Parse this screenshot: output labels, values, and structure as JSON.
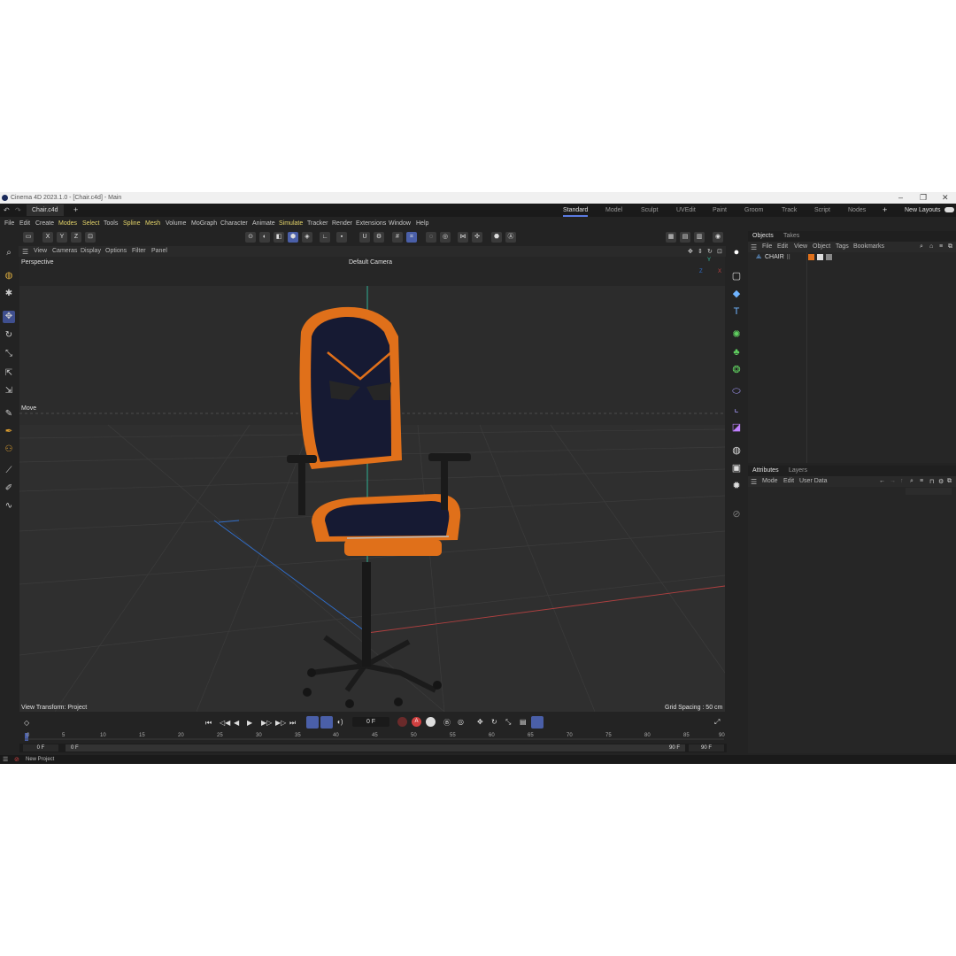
{
  "window": {
    "title": "Cinema 4D 2023.1.0 - [Chair.c4d] - Main",
    "minimize": "–",
    "maximize": "❐",
    "close": "✕"
  },
  "tabs": {
    "document": "Chair.c4d",
    "new_tab": "+"
  },
  "layouts": [
    "Standard",
    "Model",
    "Sculpt",
    "UVEdit",
    "Paint",
    "Groom",
    "Track",
    "Script",
    "Nodes"
  ],
  "layout_add": "+",
  "new_layouts": "New Layouts",
  "menu": [
    "File",
    "Edit",
    "Create",
    "Modes",
    "Select",
    "Tools",
    "Spline",
    "Mesh",
    "Volume",
    "MoGraph",
    "Character",
    "Animate",
    "Simulate",
    "Tracker",
    "Render",
    "Extensions",
    "Window",
    "Help"
  ],
  "axis_buttons": [
    "X",
    "Y",
    "Z"
  ],
  "viewport_menu": [
    "View",
    "Cameras",
    "Display",
    "Options",
    "Filter",
    "Panel"
  ],
  "viewport": {
    "projection": "Perspective",
    "camera": "Default Camera",
    "tool": "Move",
    "view_transform": "View Transform: Project",
    "grid_spacing": "Grid Spacing : 50 cm",
    "axis_labels": {
      "y": "Y",
      "z": "Z",
      "x": "X"
    }
  },
  "objects_panel": {
    "tabs": [
      "Objects",
      "Takes"
    ],
    "menu": [
      "File",
      "Edit",
      "View",
      "Object",
      "Tags",
      "Bookmarks"
    ],
    "items": [
      {
        "name": "CHAIR"
      }
    ]
  },
  "attributes_panel": {
    "tabs": [
      "Attributes",
      "Layers"
    ],
    "menu": [
      "Mode",
      "Edit",
      "User Data"
    ]
  },
  "timeline": {
    "current_frame": "0 F",
    "ticks": [
      "0",
      "5",
      "10",
      "15",
      "20",
      "25",
      "30",
      "35",
      "40",
      "45",
      "50",
      "55",
      "60",
      "65",
      "70",
      "75",
      "80",
      "85",
      "90"
    ],
    "start_field": "0 F",
    "range_start": "0 F",
    "range_end": "90 F",
    "end_field": "90 F"
  },
  "status": {
    "text": "New Project"
  },
  "colors": {
    "accent": "#4a5fa8",
    "menu_highlight": "#e6d66a",
    "chair_orange": "#e0701a",
    "chair_navy": "#161a33",
    "x_axis": "#c04040",
    "y_axis": "#30c0a0",
    "z_axis": "#3070d0"
  }
}
